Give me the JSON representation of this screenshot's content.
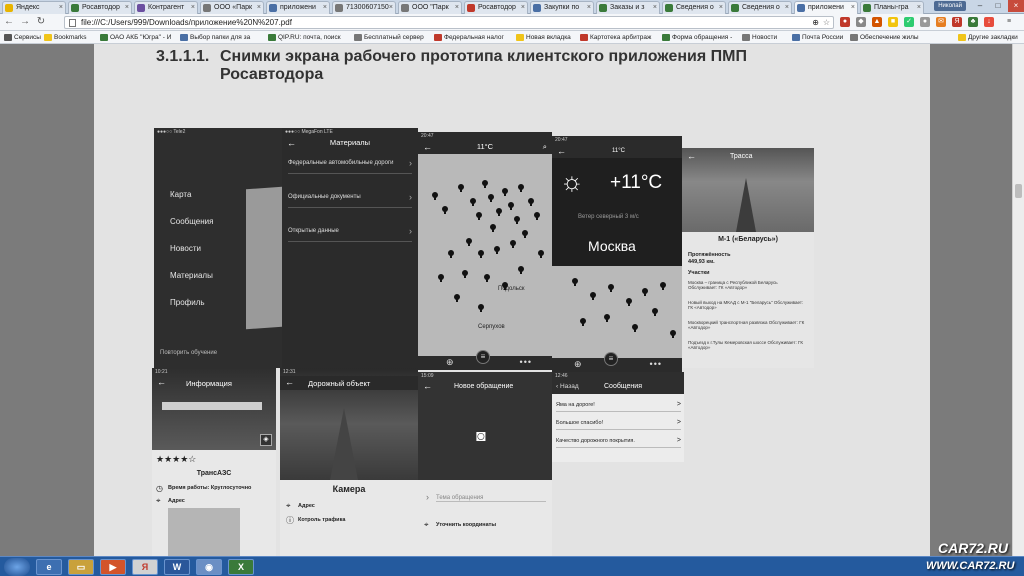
{
  "browser": {
    "tabs": [
      {
        "label": "Яндекс",
        "color": "#e8b400"
      },
      {
        "label": "Росавтодор",
        "color": "#3a7a3a"
      },
      {
        "label": "Контрагент",
        "color": "#6b4fa0"
      },
      {
        "label": "ООО «Парк",
        "color": "#777777"
      },
      {
        "label": "приложени",
        "color": "#4a6fa5"
      },
      {
        "label": "71300607150",
        "color": "#777777"
      },
      {
        "label": "ООО \"Парк",
        "color": "#777777"
      },
      {
        "label": "Росавтодор",
        "color": "#c0392b"
      },
      {
        "label": "Закупки по",
        "color": "#4a6fa5"
      },
      {
        "label": "Заказы и з",
        "color": "#3a7a3a"
      },
      {
        "label": "Сведения о",
        "color": "#3a7a3a"
      },
      {
        "label": "Сведения о",
        "color": "#3a7a3a"
      },
      {
        "label": "приложени",
        "color": "#4a6fa5",
        "active": true
      },
      {
        "label": "Планы-гра",
        "color": "#3a7a3a"
      }
    ],
    "user_badge": "Николай",
    "address": "file:///C:/Users/999/Downloads/приложение%20N%207.pdf",
    "bookmarks": [
      {
        "label": "Сервисы",
        "color": "#555555"
      },
      {
        "label": "Bookmarks",
        "color": "#f0c419"
      },
      {
        "label": "ОАО АКБ \"Югра\" - И",
        "color": "#3a7a3a"
      },
      {
        "label": "Выбор папки для за",
        "color": "#4a6fa5"
      },
      {
        "label": "QIP.RU: почта, поиск",
        "color": "#3a7a3a"
      },
      {
        "label": "Бесплатный сервер",
        "color": "#777777"
      },
      {
        "label": "Федеральная налог",
        "color": "#c0392b"
      },
      {
        "label": "Новая вкладка",
        "color": "#f0c419"
      },
      {
        "label": "Картотека арбитраж",
        "color": "#c0392b"
      },
      {
        "label": "Форма обращения -",
        "color": "#3a7a3a"
      },
      {
        "label": "Новости",
        "color": "#777777"
      },
      {
        "label": "Почта России",
        "color": "#4a6fa5"
      },
      {
        "label": "Обеспечение жилы",
        "color": "#777777"
      },
      {
        "label": "Другие закладки",
        "color": "#f0c419"
      }
    ]
  },
  "document": {
    "section_number": "3.1.1.1.",
    "section_title": "Снимки экрана рабочего прототипа клиентского приложения ПМП Росавтодора",
    "menu": {
      "items": [
        "Карта",
        "Сообщения",
        "Новости",
        "Материалы",
        "Профиль"
      ],
      "footer": "Повторить обучение"
    },
    "materials": {
      "status": "●●●○○ MegaFon LTE",
      "title": "Материалы",
      "rows": [
        "Федеральные автомобильные дороги",
        "Официальные документы",
        "Открытые данные"
      ]
    },
    "map1": {
      "status": "20:47",
      "temp": "11°C",
      "labels": [
        "Подольск",
        "Серпухов"
      ]
    },
    "map2": {
      "status": "20:47",
      "temp": "11°C"
    },
    "weather": {
      "temperature": "+11°C",
      "wind": "Ветер северный 3 м/с",
      "city": "Москва"
    },
    "road": {
      "header": "Трасса",
      "name": "М-1 («Беларусь»)",
      "length_label": "Протяжённость",
      "length": "449,93 км.",
      "segments_label": "Участки",
      "segments": [
        "Москва – граница с Республикой Беларусь Обслуживает: ГК «Автодор»",
        "Новый выход на МКАД с М-1 \"Беларусь\" Обслуживает: ГК «Автодор»",
        "Москворецкий транспортная развязка Обслуживает: ГК «Автодор»",
        "Подъезд к г.Тулы Кемеровская шоссе Обслуживает: ГК «Автодор»"
      ]
    },
    "info": {
      "time": "10:21",
      "title": "Информация",
      "rating": "★★★★☆",
      "name": "ТрансАЗС",
      "hours": "Время работы: Круглосуточно",
      "address": "Адрес"
    },
    "road_object": {
      "time": "12:31",
      "title": "Дорожный объект",
      "name": "Камера",
      "address": "Адрес",
      "traffic": "Котроль трафика"
    },
    "new_request": {
      "time": "15:09",
      "title": "Новое обращение",
      "topic_placeholder": "Тема обращения",
      "coords": "Уточнить координаты"
    },
    "messages": {
      "time": "12:46",
      "back": "Назад",
      "title": "Сообщения",
      "rows": [
        "Яма на дороге!",
        "Большое спасибо!",
        "Качество дорожного покрытия."
      ]
    }
  },
  "watermark": {
    "line1": "CAR72.RU",
    "line2": "WWW.CAR72.RU"
  }
}
